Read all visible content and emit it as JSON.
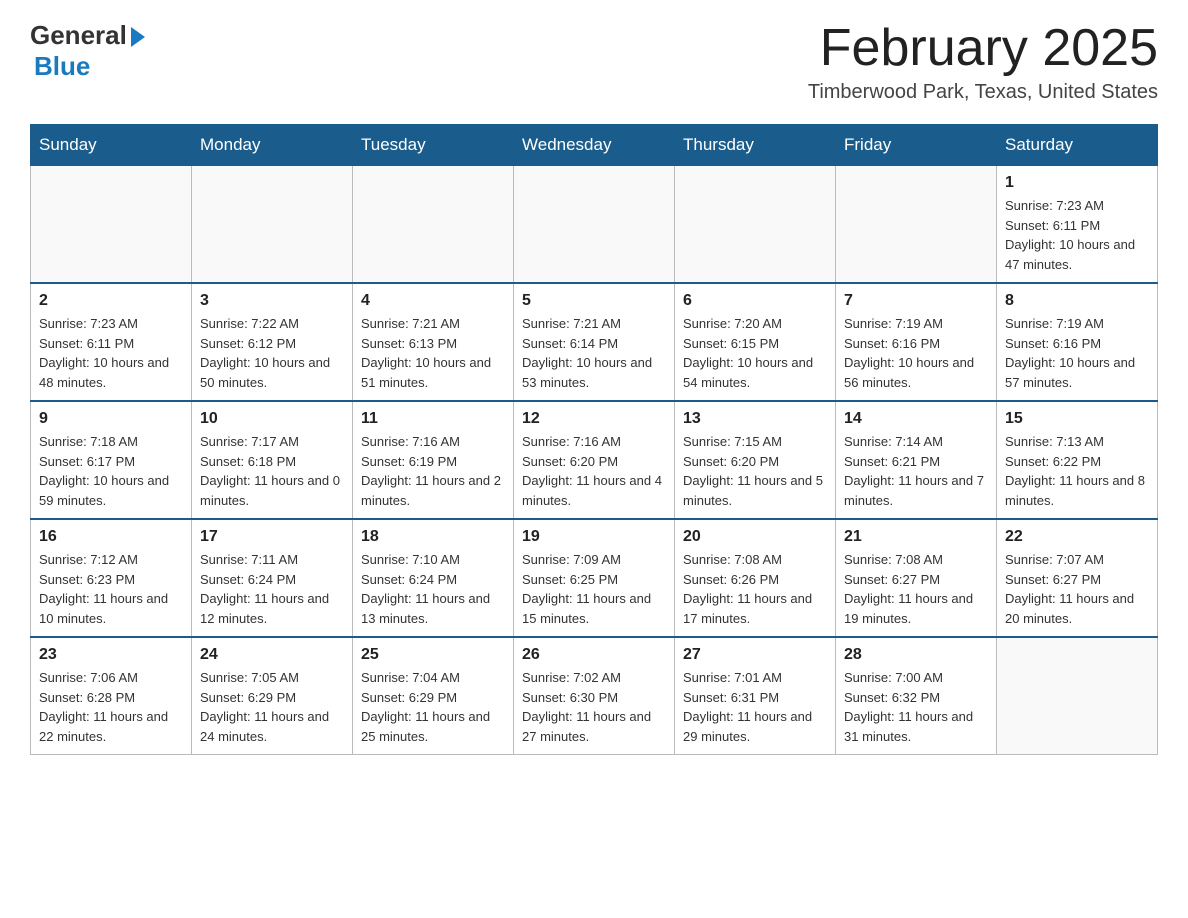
{
  "header": {
    "logo_general": "General",
    "logo_blue": "Blue",
    "month_title": "February 2025",
    "location": "Timberwood Park, Texas, United States"
  },
  "weekdays": [
    "Sunday",
    "Monday",
    "Tuesday",
    "Wednesday",
    "Thursday",
    "Friday",
    "Saturday"
  ],
  "weeks": [
    [
      {
        "day": "",
        "sunrise": "",
        "sunset": "",
        "daylight": ""
      },
      {
        "day": "",
        "sunrise": "",
        "sunset": "",
        "daylight": ""
      },
      {
        "day": "",
        "sunrise": "",
        "sunset": "",
        "daylight": ""
      },
      {
        "day": "",
        "sunrise": "",
        "sunset": "",
        "daylight": ""
      },
      {
        "day": "",
        "sunrise": "",
        "sunset": "",
        "daylight": ""
      },
      {
        "day": "",
        "sunrise": "",
        "sunset": "",
        "daylight": ""
      },
      {
        "day": "1",
        "sunrise": "Sunrise: 7:23 AM",
        "sunset": "Sunset: 6:11 PM",
        "daylight": "Daylight: 10 hours and 47 minutes."
      }
    ],
    [
      {
        "day": "2",
        "sunrise": "Sunrise: 7:23 AM",
        "sunset": "Sunset: 6:11 PM",
        "daylight": "Daylight: 10 hours and 48 minutes."
      },
      {
        "day": "3",
        "sunrise": "Sunrise: 7:22 AM",
        "sunset": "Sunset: 6:12 PM",
        "daylight": "Daylight: 10 hours and 50 minutes."
      },
      {
        "day": "4",
        "sunrise": "Sunrise: 7:21 AM",
        "sunset": "Sunset: 6:13 PM",
        "daylight": "Daylight: 10 hours and 51 minutes."
      },
      {
        "day": "5",
        "sunrise": "Sunrise: 7:21 AM",
        "sunset": "Sunset: 6:14 PM",
        "daylight": "Daylight: 10 hours and 53 minutes."
      },
      {
        "day": "6",
        "sunrise": "Sunrise: 7:20 AM",
        "sunset": "Sunset: 6:15 PM",
        "daylight": "Daylight: 10 hours and 54 minutes."
      },
      {
        "day": "7",
        "sunrise": "Sunrise: 7:19 AM",
        "sunset": "Sunset: 6:16 PM",
        "daylight": "Daylight: 10 hours and 56 minutes."
      },
      {
        "day": "8",
        "sunrise": "Sunrise: 7:19 AM",
        "sunset": "Sunset: 6:16 PM",
        "daylight": "Daylight: 10 hours and 57 minutes."
      }
    ],
    [
      {
        "day": "9",
        "sunrise": "Sunrise: 7:18 AM",
        "sunset": "Sunset: 6:17 PM",
        "daylight": "Daylight: 10 hours and 59 minutes."
      },
      {
        "day": "10",
        "sunrise": "Sunrise: 7:17 AM",
        "sunset": "Sunset: 6:18 PM",
        "daylight": "Daylight: 11 hours and 0 minutes."
      },
      {
        "day": "11",
        "sunrise": "Sunrise: 7:16 AM",
        "sunset": "Sunset: 6:19 PM",
        "daylight": "Daylight: 11 hours and 2 minutes."
      },
      {
        "day": "12",
        "sunrise": "Sunrise: 7:16 AM",
        "sunset": "Sunset: 6:20 PM",
        "daylight": "Daylight: 11 hours and 4 minutes."
      },
      {
        "day": "13",
        "sunrise": "Sunrise: 7:15 AM",
        "sunset": "Sunset: 6:20 PM",
        "daylight": "Daylight: 11 hours and 5 minutes."
      },
      {
        "day": "14",
        "sunrise": "Sunrise: 7:14 AM",
        "sunset": "Sunset: 6:21 PM",
        "daylight": "Daylight: 11 hours and 7 minutes."
      },
      {
        "day": "15",
        "sunrise": "Sunrise: 7:13 AM",
        "sunset": "Sunset: 6:22 PM",
        "daylight": "Daylight: 11 hours and 8 minutes."
      }
    ],
    [
      {
        "day": "16",
        "sunrise": "Sunrise: 7:12 AM",
        "sunset": "Sunset: 6:23 PM",
        "daylight": "Daylight: 11 hours and 10 minutes."
      },
      {
        "day": "17",
        "sunrise": "Sunrise: 7:11 AM",
        "sunset": "Sunset: 6:24 PM",
        "daylight": "Daylight: 11 hours and 12 minutes."
      },
      {
        "day": "18",
        "sunrise": "Sunrise: 7:10 AM",
        "sunset": "Sunset: 6:24 PM",
        "daylight": "Daylight: 11 hours and 13 minutes."
      },
      {
        "day": "19",
        "sunrise": "Sunrise: 7:09 AM",
        "sunset": "Sunset: 6:25 PM",
        "daylight": "Daylight: 11 hours and 15 minutes."
      },
      {
        "day": "20",
        "sunrise": "Sunrise: 7:08 AM",
        "sunset": "Sunset: 6:26 PM",
        "daylight": "Daylight: 11 hours and 17 minutes."
      },
      {
        "day": "21",
        "sunrise": "Sunrise: 7:08 AM",
        "sunset": "Sunset: 6:27 PM",
        "daylight": "Daylight: 11 hours and 19 minutes."
      },
      {
        "day": "22",
        "sunrise": "Sunrise: 7:07 AM",
        "sunset": "Sunset: 6:27 PM",
        "daylight": "Daylight: 11 hours and 20 minutes."
      }
    ],
    [
      {
        "day": "23",
        "sunrise": "Sunrise: 7:06 AM",
        "sunset": "Sunset: 6:28 PM",
        "daylight": "Daylight: 11 hours and 22 minutes."
      },
      {
        "day": "24",
        "sunrise": "Sunrise: 7:05 AM",
        "sunset": "Sunset: 6:29 PM",
        "daylight": "Daylight: 11 hours and 24 minutes."
      },
      {
        "day": "25",
        "sunrise": "Sunrise: 7:04 AM",
        "sunset": "Sunset: 6:29 PM",
        "daylight": "Daylight: 11 hours and 25 minutes."
      },
      {
        "day": "26",
        "sunrise": "Sunrise: 7:02 AM",
        "sunset": "Sunset: 6:30 PM",
        "daylight": "Daylight: 11 hours and 27 minutes."
      },
      {
        "day": "27",
        "sunrise": "Sunrise: 7:01 AM",
        "sunset": "Sunset: 6:31 PM",
        "daylight": "Daylight: 11 hours and 29 minutes."
      },
      {
        "day": "28",
        "sunrise": "Sunrise: 7:00 AM",
        "sunset": "Sunset: 6:32 PM",
        "daylight": "Daylight: 11 hours and 31 minutes."
      },
      {
        "day": "",
        "sunrise": "",
        "sunset": "",
        "daylight": ""
      }
    ]
  ]
}
